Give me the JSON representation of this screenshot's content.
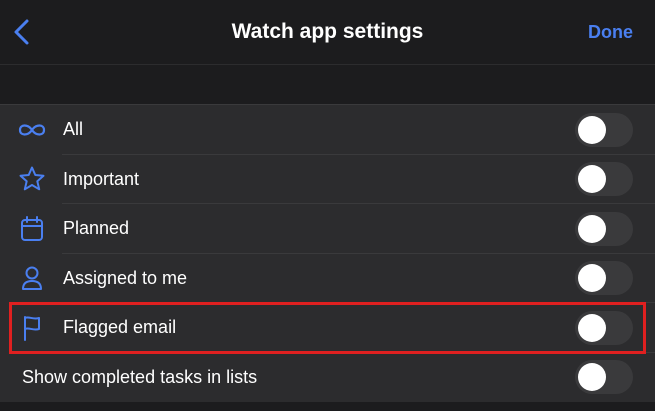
{
  "header": {
    "title": "Watch app settings",
    "done_label": "Done"
  },
  "colors": {
    "accent": "#4a7ff0",
    "background": "#1c1c1e",
    "row_background": "#2c2c2e",
    "toggle_off": "#3a3a3c",
    "highlight": "#e02020"
  },
  "settings": {
    "items": [
      {
        "label": "All",
        "icon": "infinity-icon",
        "enabled": false
      },
      {
        "label": "Important",
        "icon": "star-icon",
        "enabled": false
      },
      {
        "label": "Planned",
        "icon": "calendar-icon",
        "enabled": false
      },
      {
        "label": "Assigned to me",
        "icon": "person-icon",
        "enabled": false
      },
      {
        "label": "Flagged email",
        "icon": "flag-icon",
        "enabled": false,
        "highlighted": true
      },
      {
        "label": "Show completed tasks in lists",
        "enabled": false
      }
    ]
  }
}
